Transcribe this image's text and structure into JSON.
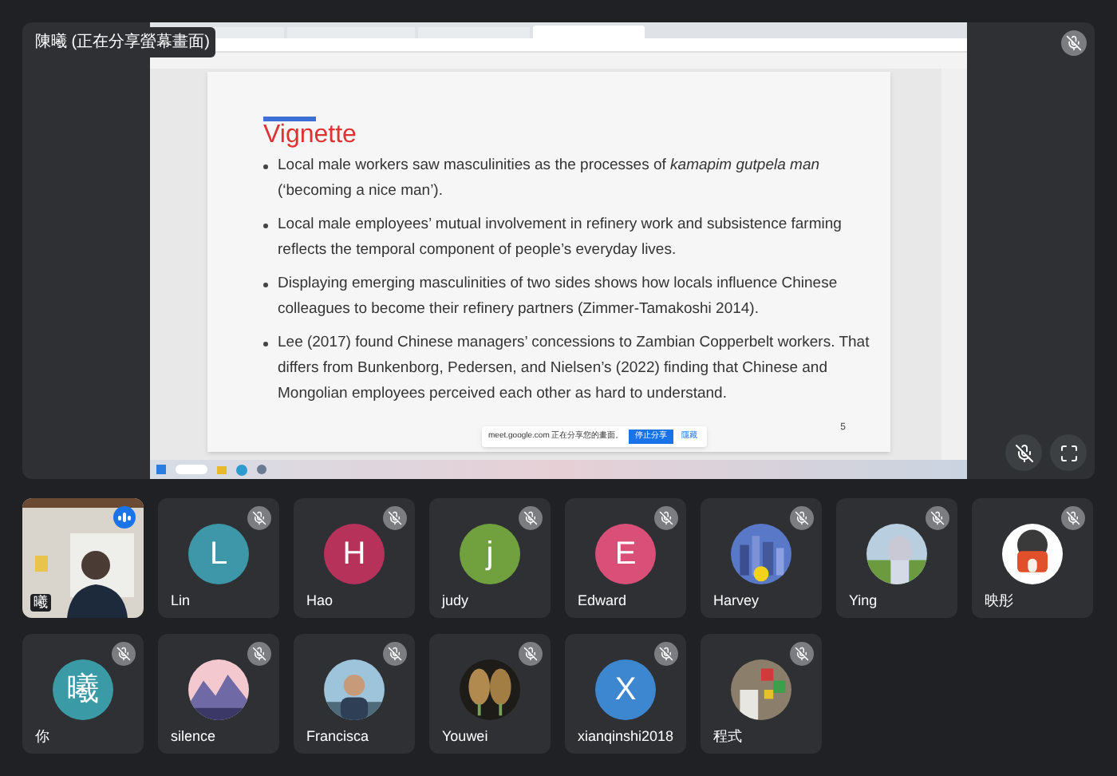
{
  "stage": {
    "presenter_label": "陳曦 (正在分享螢幕畫面)",
    "muted": true
  },
  "slide": {
    "title": "Vignette",
    "bullets": [
      "Local male workers saw masculinities as the processes of *kamapim gutpela man* (‘becoming a nice man’).",
      "Local male employees’ mutual involvement in refinery work and subsistence farming reflects the temporal component of people’s everyday lives.",
      "Displaying emerging masculinities of two sides shows how locals influence Chinese colleagues to become their refinery partners (Zimmer-Tamakoshi 2014).",
      "Lee (2017) found Chinese managers’ concessions to Zambian Copperbelt workers. That differs from Bunkenborg, Pedersen, and Nielsen’s (2022) finding that Chinese and Mongolian employees perceived each other as hard to understand."
    ],
    "page": "5"
  },
  "share_bar": {
    "message": "meet.google.com 正在分享您的畫面。",
    "stop": "停止分享",
    "hide": "隱藏"
  },
  "participants": [
    {
      "name": "曦",
      "kind": "camera",
      "muted": false,
      "speaking": true
    },
    {
      "name": "Lin",
      "kind": "letter",
      "initial": "L",
      "color": "#3e97a8",
      "muted": true,
      "speaking": false
    },
    {
      "name": "Hao",
      "kind": "letter",
      "initial": "H",
      "color": "#b7325a",
      "muted": true,
      "speaking": false
    },
    {
      "name": "judy",
      "kind": "letter",
      "initial": "j",
      "color": "#71a03f",
      "muted": true,
      "speaking": false
    },
    {
      "name": "Edward",
      "kind": "letter",
      "initial": "E",
      "color": "#d94f77",
      "muted": true,
      "speaking": false
    },
    {
      "name": "Harvey",
      "kind": "picture",
      "muted": true,
      "speaking": false
    },
    {
      "name": "Ying",
      "kind": "picture",
      "muted": true,
      "speaking": false
    },
    {
      "name": "映彤",
      "kind": "picture",
      "muted": true,
      "speaking": false
    },
    {
      "name": "你",
      "kind": "letter",
      "initial": "曦",
      "color": "#3a9aa6",
      "muted": true,
      "speaking": false
    },
    {
      "name": "silence",
      "kind": "picture",
      "muted": true,
      "speaking": false
    },
    {
      "name": "Francisca",
      "kind": "picture",
      "muted": true,
      "speaking": false
    },
    {
      "name": "Youwei",
      "kind": "picture",
      "muted": true,
      "speaking": false
    },
    {
      "name": "xianqinshi2018",
      "kind": "letter",
      "initial": "X",
      "color": "#3d86d0",
      "muted": true,
      "speaking": false
    },
    {
      "name": "程式",
      "kind": "picture",
      "muted": true,
      "speaking": false
    }
  ]
}
